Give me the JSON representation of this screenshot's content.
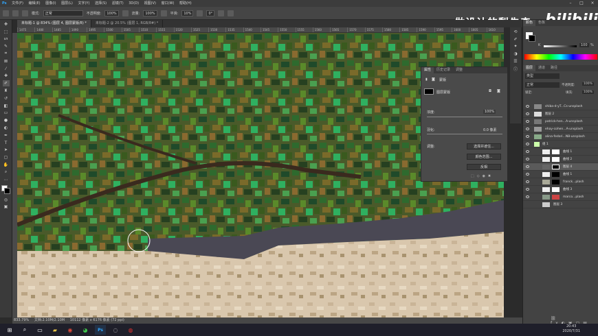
{
  "menu": {
    "logo": "Ps",
    "items": [
      "文件(F)",
      "编辑(E)",
      "图像(I)",
      "图层(L)",
      "文字(Y)",
      "选择(S)",
      "滤镜(T)",
      "3D(D)",
      "视图(V)",
      "窗口(W)",
      "帮助(H)"
    ],
    "window_controls": [
      "–",
      "□",
      "×"
    ]
  },
  "options": {
    "mode_label": "模式:",
    "mode_value": "正常",
    "opacity_label": "不透明度:",
    "opacity_value": "100%",
    "flow_label": "流量:",
    "flow_value": "100%",
    "smooth_label": "平滑:",
    "smooth_value": "10%",
    "angle_value": "0°"
  },
  "tabs": [
    {
      "label": "未标题-1 @ 834% (图层 4, 图层蒙版/8) *"
    },
    {
      "label": "未标题-2 @ 20.5% (图层 1, RGB/8#) *"
    }
  ],
  "ruler_ticks": [
    "1475",
    "1480",
    "1485",
    "1490",
    "1495",
    "1500",
    "1505",
    "1510",
    "1515",
    "1520",
    "1525",
    "1530",
    "1535",
    "1540",
    "1545",
    "1550",
    "1555",
    "1560",
    "1565",
    "1570",
    "1575",
    "1580",
    "1585",
    "1590",
    "1595",
    "1600",
    "1605",
    "1610"
  ],
  "watermark": {
    "text": "做设计的梨先森",
    "brand": "bilibili"
  },
  "properties": {
    "tabs": [
      "属性",
      "历史记录",
      "调整"
    ],
    "title": "蒙版",
    "type_label": "图层蒙版",
    "density_label": "浓度:",
    "density_value": "100%",
    "feather_label": "羽化:",
    "feather_value": "0.0 像素",
    "adjust_label": "调整:",
    "btn_select_mask": "选择并遮住...",
    "btn_color_range": "颜色范围...",
    "btn_invert": "反相"
  },
  "color_panel": {
    "tabs": [
      "颜色",
      "色板"
    ],
    "k_label": "K",
    "k_value": "100",
    "pct": "%"
  },
  "layers_panel": {
    "tabs": [
      "图层",
      "通道",
      "路径"
    ],
    "kind_label": "类型",
    "blend_value": "正常",
    "opacity_label": "不透明度:",
    "opacity_value": "100%",
    "lock_label": "锁定:",
    "fill_label": "填充:",
    "fill_value": "100%",
    "layers": [
      {
        "name": "shiba-d-yT...Cs-unsplash",
        "type": "photo"
      },
      {
        "name": "图层 2",
        "type": "empty"
      },
      {
        "name": "patrick-hen...A-unsplash",
        "type": "photo"
      },
      {
        "name": "ehay-cohen...A-unsplash",
        "type": "photo"
      },
      {
        "name": "alina-fedori...N8-unsplash",
        "type": "photo"
      },
      {
        "name": "组 1",
        "type": "group"
      },
      {
        "name": "曲线 1",
        "type": "adjust"
      },
      {
        "name": "曲线 2",
        "type": "adjust"
      },
      {
        "name": "图层 4",
        "type": "mask",
        "selected": true
      },
      {
        "name": "曲线 1",
        "type": "adjust"
      },
      {
        "name": "franck...plash",
        "type": "photo"
      },
      {
        "name": "曲线 3",
        "type": "adjust"
      },
      {
        "name": "marco...plash",
        "type": "photo"
      },
      {
        "name": "图层 3",
        "type": "empty"
      }
    ]
  },
  "status": {
    "zoom": "833.79%",
    "doc": "文档:2.10M/2.10M",
    "info": "10112 像素 x 6176 像素 (72 ppi)"
  },
  "taskbar": {
    "icons": [
      "windows-logo",
      "search",
      "task-view",
      "explorer",
      "chrome",
      "wechat",
      "photoshop",
      "app",
      "netease-music"
    ]
  },
  "clock": {
    "time": "20:43",
    "date": "2020/7/31"
  }
}
